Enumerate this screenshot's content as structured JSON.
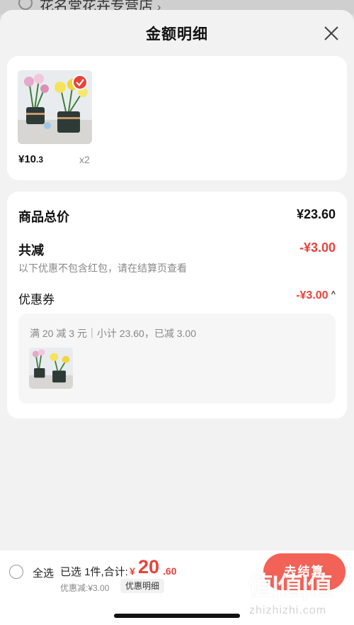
{
  "background": {
    "shop_name": "花名堂花卉专营店",
    "chevron": "›"
  },
  "sheet": {
    "title": "金额明细"
  },
  "item": {
    "price_int": "¥10",
    "price_dec": ".3",
    "quantity": "x2"
  },
  "summary": {
    "total_label": "商品总价",
    "total_value": "¥23.60",
    "reduce_label": "共减",
    "reduce_value": "-¥3.00",
    "hint": "以下优惠不包含红包，请在结算页查看",
    "coupon_label": "优惠券",
    "coupon_value": "-¥3.00",
    "coupon_caret": "^",
    "coupon_detail": "满 20 减 3 元｜小计 23.60，已减 3.00"
  },
  "bottom_bar": {
    "select_all": "全选",
    "selected_text": "已选 1件,合计:",
    "total_symbol": "¥",
    "total_int": "20",
    "total_dec": ".60",
    "discount_text": "优惠减:¥3.00",
    "detail_button": "优惠明细",
    "checkout_button": "去结算"
  },
  "watermark": {
    "logo": "值|值|值",
    "url": "zhizhizhi.com"
  },
  "colors": {
    "accent": "#e8433b",
    "checkout": "#f26257"
  }
}
